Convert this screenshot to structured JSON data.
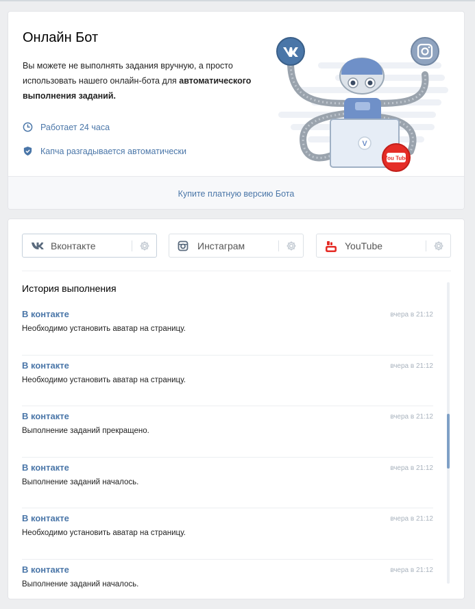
{
  "bot": {
    "title": "Онлайн Бот",
    "description_plain": "Вы можете не выполнять задания вручную, а просто использовать нашего онлайн-бота для ",
    "description_bold": "автоматического выполнения заданий.",
    "features": [
      {
        "icon": "clock-icon",
        "label": "Работает 24 часа"
      },
      {
        "icon": "shield-icon",
        "label": "Капча разгадывается автоматически"
      }
    ],
    "illustration_badges": {
      "laptop_logo": "V",
      "youtube_badge": "You Tube"
    },
    "buy_label": "Купите платную версию Бота"
  },
  "tabs": [
    {
      "icon": "vk-icon",
      "label": "Вконтакте",
      "active": true
    },
    {
      "icon": "instagram-icon",
      "label": "Инстаграм",
      "active": false
    },
    {
      "icon": "youtube-icon",
      "label": "YouTube",
      "active": false
    }
  ],
  "history": {
    "title": "История выполнения",
    "items": [
      {
        "source": "В контакте",
        "time": "вчера в 21:12",
        "text": "Необходимо установить аватар на страницу."
      },
      {
        "source": "В контакте",
        "time": "вчера в 21:12",
        "text": "Необходимо установить аватар на страницу."
      },
      {
        "source": "В контакте",
        "time": "вчера в 21:12",
        "text": "Выполнение заданий прекращено."
      },
      {
        "source": "В контакте",
        "time": "вчера в 21:12",
        "text": "Выполнение заданий началось."
      },
      {
        "source": "В контакте",
        "time": "вчера в 21:12",
        "text": "Необходимо установить аватар на страницу."
      },
      {
        "source": "В контакте",
        "time": "вчера в 21:12",
        "text": "Выполнение заданий началось."
      }
    ]
  },
  "colors": {
    "accent": "#4a76a8",
    "background": "#edeef0",
    "youtube_red": "#e52d27",
    "muted_time": "#a9b3be"
  }
}
